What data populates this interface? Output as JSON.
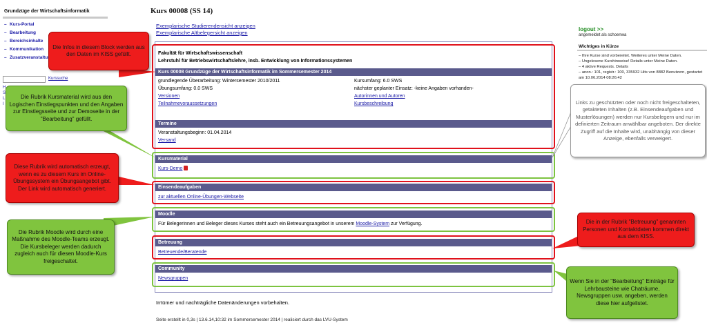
{
  "sidebar": {
    "title": "Grundzüge der Wirtschaftsinformatik",
    "items": [
      {
        "label": "Kurs-Portal"
      },
      {
        "label": "Bearbeitung"
      },
      {
        "label": "Bereichsinhalte"
      },
      {
        "label": "Kommunikation"
      },
      {
        "label": "Zusatzveranstaltung"
      }
    ],
    "search_button": "Kurssuche",
    "tiny_links": [
      "H",
      "S",
      "L",
      "I"
    ]
  },
  "header": {
    "title": "Kurs 00008 (SS 14)",
    "link_student_view": "Exemplarische Studierendensicht anzeigen",
    "link_old_view": "Exemplarische Altbelegersicht anzeigen"
  },
  "faculty": {
    "name": "Fakultät für Wirtschaftswissenschaft",
    "chair": "Lehrstuhl für Betriebswirtschaftslehre, insb. Entwicklung von Informationssystemen"
  },
  "course": {
    "heading": "Kurs 00008 Grundzüge der Wirtschaftsinformatik im Sommersemester 2014",
    "revision": "grundlegende Überarbeitung: Wintersemester 2010/2011",
    "scope": "Kursumfang: 6.0 SWS",
    "exercise_scope": "Übungsumfang: 0.0 SWS",
    "next_use": "nächster geplanter Einsatz: -keine Angaben vorhanden-",
    "link_versions": "Versionen",
    "link_authors": "Autorinnen und Autoren",
    "link_prereq": "Teilnahmevoraussetzungen",
    "link_description": "Kursbeschreibung"
  },
  "termine": {
    "heading": "Termine",
    "start": "Veranstaltungsbeginn: 01.04.2014",
    "link_shipping": "Versand"
  },
  "kursmaterial": {
    "heading": "Kursmaterial",
    "link_demo": "Kurs-Demo"
  },
  "einsendeaufgaben": {
    "heading": "Einsendeaufgaben",
    "link": "zur aktuellen Online-Übungen-Webseite"
  },
  "moodle": {
    "heading": "Moodle",
    "text_before": "Für Belegerinnen und Beleger dieses Kurses steht auch ein Betreuungsangebot in unserem ",
    "link": "Moodle-System",
    "text_after": " zur Verfügung."
  },
  "betreuung": {
    "heading": "Betreuung",
    "link": "Betreuende/Beratende"
  },
  "community": {
    "heading": "Community",
    "link": "Newsgruppen"
  },
  "footer": {
    "disclaimer": "Irrtümer und nachträgliche Datenänderungen vorbehalten.",
    "generated": "Seite erstellt in 0,3s   |   13.6.14,10:32 im Sommersemester 2014   |   realisiert durch das LVU-System"
  },
  "right": {
    "logout": "logout >>",
    "user": "angemeldet als schoenwa",
    "title": "Wichtiges in Kürze",
    "items": [
      "– Ihre Kurse sind vorbereitet. Weiteres unter Meine Daten.",
      "– Ungelesene Kurshinweise! Details unter Meine Daten.",
      "– 4 aktive Requests. Details",
      "– anon.: 101, registr.: 100, 335932 Hits von 8882 Benutzern, gestartet am 10.06.2014 08:26:42"
    ]
  },
  "notes": {
    "kiss_info": "Die Infos in diesem Block werden aus den Daten im KISS gefüllt.",
    "kursmaterial": "Die Rubrik Kursmaterial wird aus den Logischen Einstiegspunkten und den Angaben zur Einstiegsseite und zur Demoseite in der \"Bearbeitung\" gefüllt.",
    "einsende": "Diese Rubrik wird automatisch erzeugt, wenn es zu diesem Kurs im Online-Übungssystem ein Übungsangebot gibt. Der Link wird automatisch generiert.",
    "moodle": "Die Rubrik Moodle wird durch eine Maßnahme des Moodle-Teams erzeugt. Die Kursbeleger werden dadurch zugleich auch für diesen Moodle-Kurs freigeschaltet.",
    "protected_links": "Links zu geschützten oder noch nicht freigeschalteten, getakteten Inhalten (z.B. Einsendeaufgaben und Musterlösungen) werden nur Kursbelegern und nur im definierten Zeitraum anwählbar angeboten. Der direkte Zugriff auf die Inhalte wird, unabhängig von dieser Anzeige, ebenfalls verweigert.",
    "betreuung": "Die in der Rubrik \"Betreuung\" genannten Personen und Kontaktdaten kommen direkt aus dem KISS.",
    "community": "Wenn Sie in der \"Bearbeitung\" Einträge für Lehrbausteine wie Chaträume, Newsgruppen usw. angeben, werden diese hier aufgelistet."
  },
  "colors": {
    "section_header": "#5a5a8c",
    "link": "#1a1aa6",
    "note_red": "#ee1c1c",
    "note_green": "#80c43e",
    "logout": "#1e8a1e"
  }
}
